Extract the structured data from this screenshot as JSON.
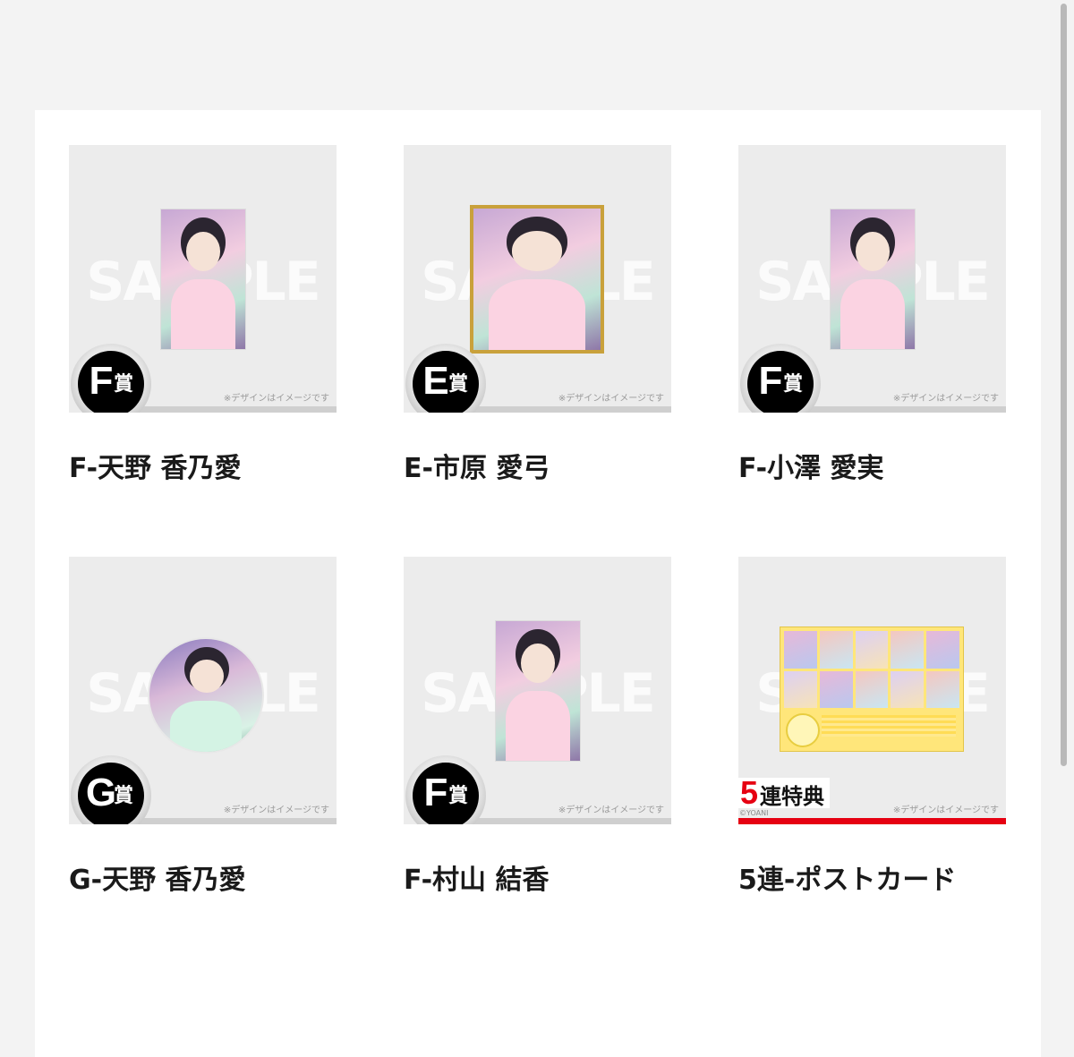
{
  "watermark": "SAMPLE",
  "note": "※デザインはイメージです",
  "badge_suffix": "賞",
  "items": [
    {
      "badge": "F",
      "title": "F-天野 香乃愛"
    },
    {
      "badge": "E",
      "title": "E-市原 愛弓"
    },
    {
      "badge": "F",
      "title": "F-小澤 愛実"
    },
    {
      "badge": "G",
      "title": "G-天野 香乃愛"
    },
    {
      "badge": "F",
      "title": "F-村山 結香"
    },
    {
      "rensu_number": "5",
      "rensu_text": "連特典",
      "copyright": "©YOANI",
      "title": "5連-ポストカード"
    }
  ],
  "colors": {
    "accent": "#e60012",
    "page_bg": "#f3f3f3",
    "card_bg": "#ececec"
  }
}
